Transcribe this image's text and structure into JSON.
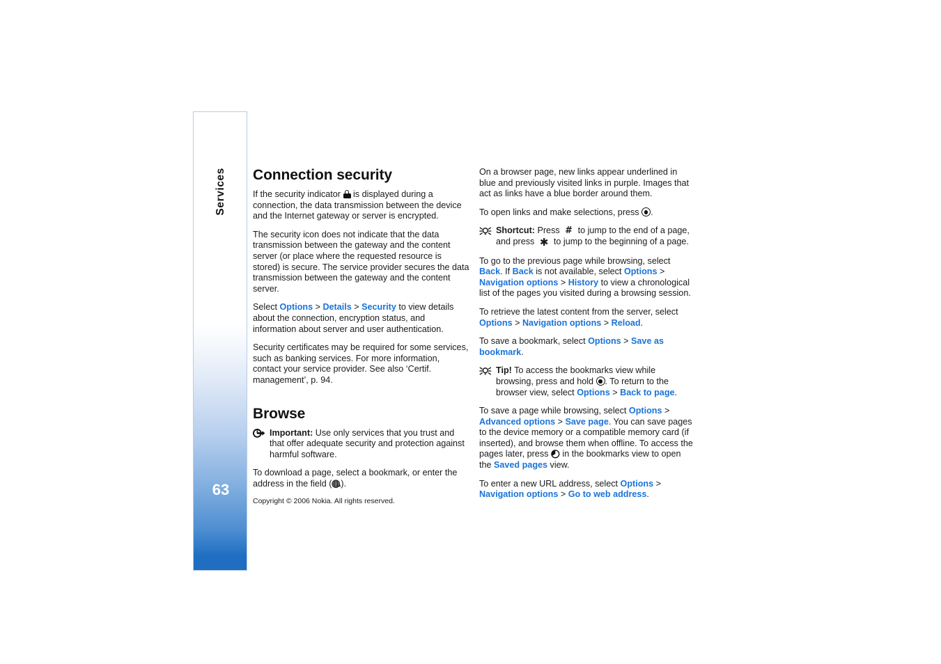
{
  "document": {
    "page_number": "63",
    "sidebar_tab_label": "Services",
    "footer": "Copyright © 2006 Nokia. All rights reserved.",
    "accent_color": "#1a73d8",
    "sidebar_bottom_color": "#1f6ec2"
  },
  "left_column": {
    "heading_1": "Connection security",
    "para_1_a": "If the security indicator ",
    "lock_icon": "padlock-icon",
    "para_1_b": " is displayed during a connection, the data transmission between the device and the Internet gateway or server is encrypted.",
    "para_2": "The security icon does not indicate that the data transmission between the gateway and the content server (or place where the requested resource is stored) is secure. The service provider secures the data transmission between the gateway and the content server.",
    "para_3_pre": "Select ",
    "para_3_link1": "Options",
    "para_3_sep1": " > ",
    "para_3_link2": "Details",
    "para_3_sep2": " > ",
    "para_3_link3": "Security",
    "para_3_post": " to view details about the connection, encryption status, and information about server and user authentication.",
    "para_4": "Security certificates may be required for some services, such as banking services. For more information, contact your service provider. See also ‘Certif. management’, p. 94.",
    "heading_2": "Browse",
    "important_icon": "important-arrow-icon",
    "important_label": "Important:",
    "important_text": " Use only services that you trust and that offer adequate security and protection against harmful software.",
    "para_5_a": "To download a page, select a bookmark, or enter the address in the field (",
    "globe_icon": "globe-icon",
    "para_5_b": ")."
  },
  "right_column": {
    "para_1": "On a browser page, new links appear underlined in blue and previously visited links in purple. Images that act as links have a blue border around them.",
    "para_2_a": "To open links and make selections, press ",
    "navikey_icon": "navi-key-icon",
    "para_2_b": ".",
    "shortcut_icon": "tip-bulb-icon",
    "shortcut_label": "Shortcut:",
    "shortcut_text_a": " Press ",
    "shortcut_key_hash": "#",
    "shortcut_text_b": " to jump to the end of a page, and press ",
    "shortcut_key_star": "✱",
    "shortcut_text_c": " to jump to the beginning of a page.",
    "para_3_a": "To go to the previous page while browsing, select ",
    "para_3_link1": "Back",
    "para_3_b": ". If ",
    "para_3_link2": "Back",
    "para_3_c": " is not available, select ",
    "para_3_link3": "Options",
    "para_3_sep1": " > ",
    "para_3_link4": "Navigation options",
    "para_3_sep2": " > ",
    "para_3_link5": "History",
    "para_3_d": " to view a chronological list of the pages you visited during a browsing session.",
    "para_4_a": "To retrieve the latest content from the server, select ",
    "para_4_link1": "Options",
    "para_4_sep1": " > ",
    "para_4_link2": "Navigation options",
    "para_4_sep2": " > ",
    "para_4_link3": "Reload",
    "para_4_b": ".",
    "para_5_a": "To save a bookmark, select ",
    "para_5_link1": "Options",
    "para_5_sep1": " > ",
    "para_5_link2": "Save as bookmark",
    "para_5_b": ".",
    "tip_icon": "tip-bulb-icon",
    "tip_label": "Tip!",
    "tip_text_a": " To access the bookmarks view while browsing, press and hold ",
    "tip_navikey_icon": "navi-key-icon",
    "tip_text_b": ". To return to the browser view, select ",
    "tip_link1": "Options",
    "tip_sep1": " > ",
    "tip_link2": "Back to page",
    "tip_text_c": ".",
    "para_6_a": "To save a page while browsing, select ",
    "para_6_link1": "Options",
    "para_6_sep1": " > ",
    "para_6_link2": "Advanced options",
    "para_6_sep2": " > ",
    "para_6_link3": "Save page",
    "para_6_b": ". You can save pages to the device memory or a compatible memory card (if inserted), and browse them when offline. To access the pages later, press ",
    "scrollleft_icon": "scroll-left-key-icon",
    "para_6_c": " in the bookmarks view to open the ",
    "para_6_link4": "Saved pages",
    "para_6_d": " view.",
    "para_7_a": "To enter a new URL address, select ",
    "para_7_link1": "Options",
    "para_7_sep1": " > ",
    "para_7_link2": "Navigation options",
    "para_7_sep2": " > ",
    "para_7_link3": "Go to web address",
    "para_7_b": "."
  }
}
